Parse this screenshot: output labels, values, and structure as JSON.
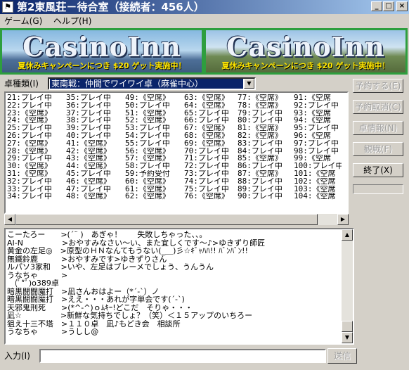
{
  "window": {
    "title": "第2東風荘－待合室（接続者：456人）",
    "app_icon": "flag-icon",
    "minimize_glyph": "_",
    "maximize_glyph": "□",
    "close_glyph": "×"
  },
  "menu": [
    {
      "label": "ゲーム(G)"
    },
    {
      "label": "ヘルプ(H)"
    }
  ],
  "banners": [
    {
      "logo": "CasinoInn",
      "promo": "夏休みキャンペーンにつき $20 ゲット実施中！"
    },
    {
      "logo": "CasinoInn",
      "promo": "夏休みキャンペーンにつき $20 ゲット実施中！"
    }
  ],
  "table_type": {
    "label": "卓種類(I)",
    "selected": "東南戦：仲間でワイワイ卓（麻雀中心）"
  },
  "side_buttons": [
    {
      "label": "予約する(E)",
      "enabled": false
    },
    {
      "label": "予約取消(C)",
      "enabled": false
    },
    {
      "label": "卓情報(N)",
      "enabled": false
    },
    {
      "label": "観戦(F)",
      "enabled": false
    },
    {
      "label": "終了(X)",
      "enabled": true
    }
  ],
  "tables": [
    [
      "21:プレイ中",
      "35:プレイ中",
      "49:《空席》",
      "63:《空席》",
      "77:《空席》",
      "91:《空席"
    ],
    [
      "22:プレイ中",
      "36:プレイ中",
      "50:プレイ中",
      "64:《空席》",
      "78:《空席》",
      "92:プレイ中"
    ],
    [
      "23:《空席》",
      "37:プレイ中",
      "51:《空席》",
      "65:プレイ中",
      "79:プレイ中",
      "93:《空席"
    ],
    [
      "24:《空席》",
      "38:プレイ中",
      "52:《空席》",
      "66:プレイ中",
      "80:プレイ中",
      "94:《空席"
    ],
    [
      "25:プレイ中",
      "39:プレイ中",
      "53:プレイ中",
      "67:《空席》",
      "81:《空席》",
      "95:プレイ中"
    ],
    [
      "26:プレイ中",
      "40:プレイ中",
      "54:プレイ中",
      "68:《空席》",
      "82:《空席》",
      "96:《空席"
    ],
    [
      "27:《空席》",
      "41:《空席》",
      "55:プレイ中",
      "69:《空席》",
      "83:プレイ中",
      "97:プレイ中"
    ],
    [
      "28:《空席》",
      "42:《空席》",
      "56:《空席》",
      "70:プレイ中",
      "84:プレイ中",
      "98:プレイ中"
    ],
    [
      "29:プレイ中",
      "43:《空席》",
      "57:《空席》",
      "71:プレイ中",
      "85:《空席》",
      "99:《空席"
    ],
    [
      "30:《空席》",
      "44:《空席》",
      "58:プレイ中",
      "72:プレイ中",
      "86:プレイ中",
      "100:プレイ中"
    ],
    [
      "31:《空席》",
      "45:プレイ中",
      "59:予約受付",
      "73:プレイ中",
      "87:《空席》",
      "101:《空席"
    ],
    [
      "32:プレイ中",
      "46:《空席》",
      "60:《空席》",
      "74:プレイ中",
      "88:プレイ中",
      "102:《空席"
    ],
    [
      "33:プレイ中",
      "47:プレイ中",
      "61:《空席》",
      "75:プレイ中",
      "89:プレイ中",
      "103:《空席"
    ],
    [
      "34:プレイ中",
      "48:《空席》",
      "62:《空席》",
      "76:《空席》",
      "90:プレイ中",
      "104:《空席"
    ]
  ],
  "chat": [
    "こーたろー　　>(´¨ )　あぎゃ！　　失敗しちゃった、、。",
    "AI-N　　　　　>おやすみなさい～い、また宜しくです～♪>ゆきずり師匠",
    "黄金の左足◎　>原型のＨＮなんてもうない(_＿)彡☆ｷﾞｬﾊﾊ!! ﾊﾞﾝﾊﾞﾝ!!",
    "無鐵鈴鹿　　　>おやすみです>ゆきずりさん",
    "ルパソ3家和　 >いや、左足はブレーメでしょう、うんうん",
    "うなちゃ　　　>",
    "　(ﾟ*ﾟ)o389卓",
    "暗黒闘闘魔打　>凪さんおはよー（*´-`）ノ",
    "暗黒闘闘魔打　>ええ・・・あれが字単会です(´-`)",
    "天邪鬼刑死　　>(*^-^)ｏﾑｷｰ!どこだ　そりゃ・・・",
    "凪☆　　　　　>新鮮な気持ちでしょ？（笑）＜１５アップのいちろー",
    "狙え十三不塔　>１１０卓　凪♪もどき会　相談所",
    "うなちゃ　　　>うしし@"
  ],
  "input": {
    "label": "入力(I)",
    "value": "",
    "send_label": "送信"
  }
}
